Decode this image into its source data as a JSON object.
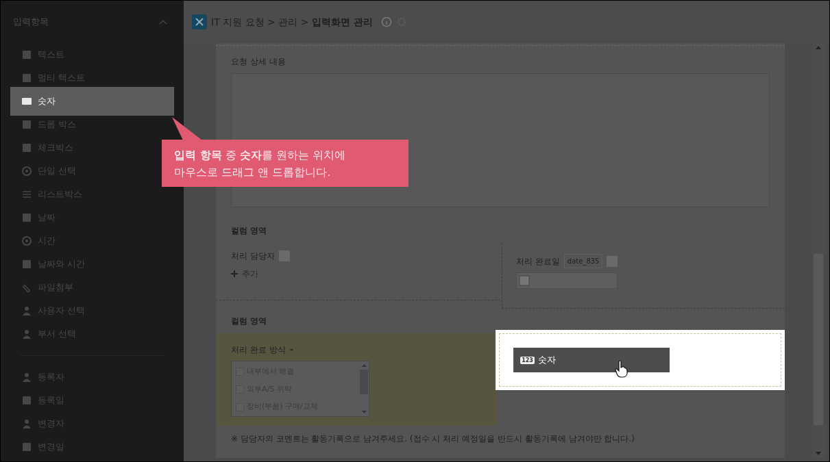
{
  "sidebar": {
    "title": "입력항목",
    "groups": [
      [
        {
          "label": "텍스트",
          "selected": false
        },
        {
          "label": "멀티 텍스트",
          "selected": false
        },
        {
          "label": "숫자",
          "selected": true
        },
        {
          "label": "드롭 박스",
          "selected": false
        },
        {
          "label": "체크박스",
          "selected": false
        },
        {
          "label": "단일 선택",
          "selected": false
        },
        {
          "label": "리스트박스",
          "selected": false
        },
        {
          "label": "날짜",
          "selected": false
        },
        {
          "label": "시간",
          "selected": false
        },
        {
          "label": "날짜와 시간",
          "selected": false
        },
        {
          "label": "파일첨부",
          "selected": false
        },
        {
          "label": "사용자 선택",
          "selected": false
        },
        {
          "label": "부서 선택",
          "selected": false
        }
      ],
      [
        {
          "label": "등록자",
          "selected": false
        },
        {
          "label": "등록일",
          "selected": false
        },
        {
          "label": "변경자",
          "selected": false
        },
        {
          "label": "변경일",
          "selected": false
        }
      ]
    ]
  },
  "header": {
    "breadcrumb": "IT 지원 요청 > 관리 > **입력화면 관리**"
  },
  "tooltip": {
    "lines": [
      "**입력 항목** 중 **숫자**를 원하는 위치에",
      "마우스로 드래그 앤 드롭합니다."
    ]
  },
  "form": {
    "detail_label": "요청 상세 내용",
    "sections": [
      {
        "title": "컬럼 영역",
        "left": {
          "label": "처리 담당자",
          "add": "추가"
        },
        "right": {
          "label": "처리 완료일",
          "code": "date_835"
        }
      },
      {
        "title": "컬럼 영역",
        "left": {
          "label": "처리 완료 방식",
          "required": "-",
          "options": [
            {
              "label": "내부에서 해결",
              "checked": false
            },
            {
              "label": "외부A/S 위탁",
              "checked": false
            },
            {
              "label": "장비(부품) 구매/교체",
              "checked": false
            }
          ]
        },
        "right": {
          "drag_item": "숫자",
          "drag_badge": "123"
        }
      }
    ],
    "note": "※ 담당자의 코멘트는 활동기록으로 남겨주세요. (접수 시 처리 예정일을 반드시  활동기록에 남겨야만 합니다.)"
  }
}
